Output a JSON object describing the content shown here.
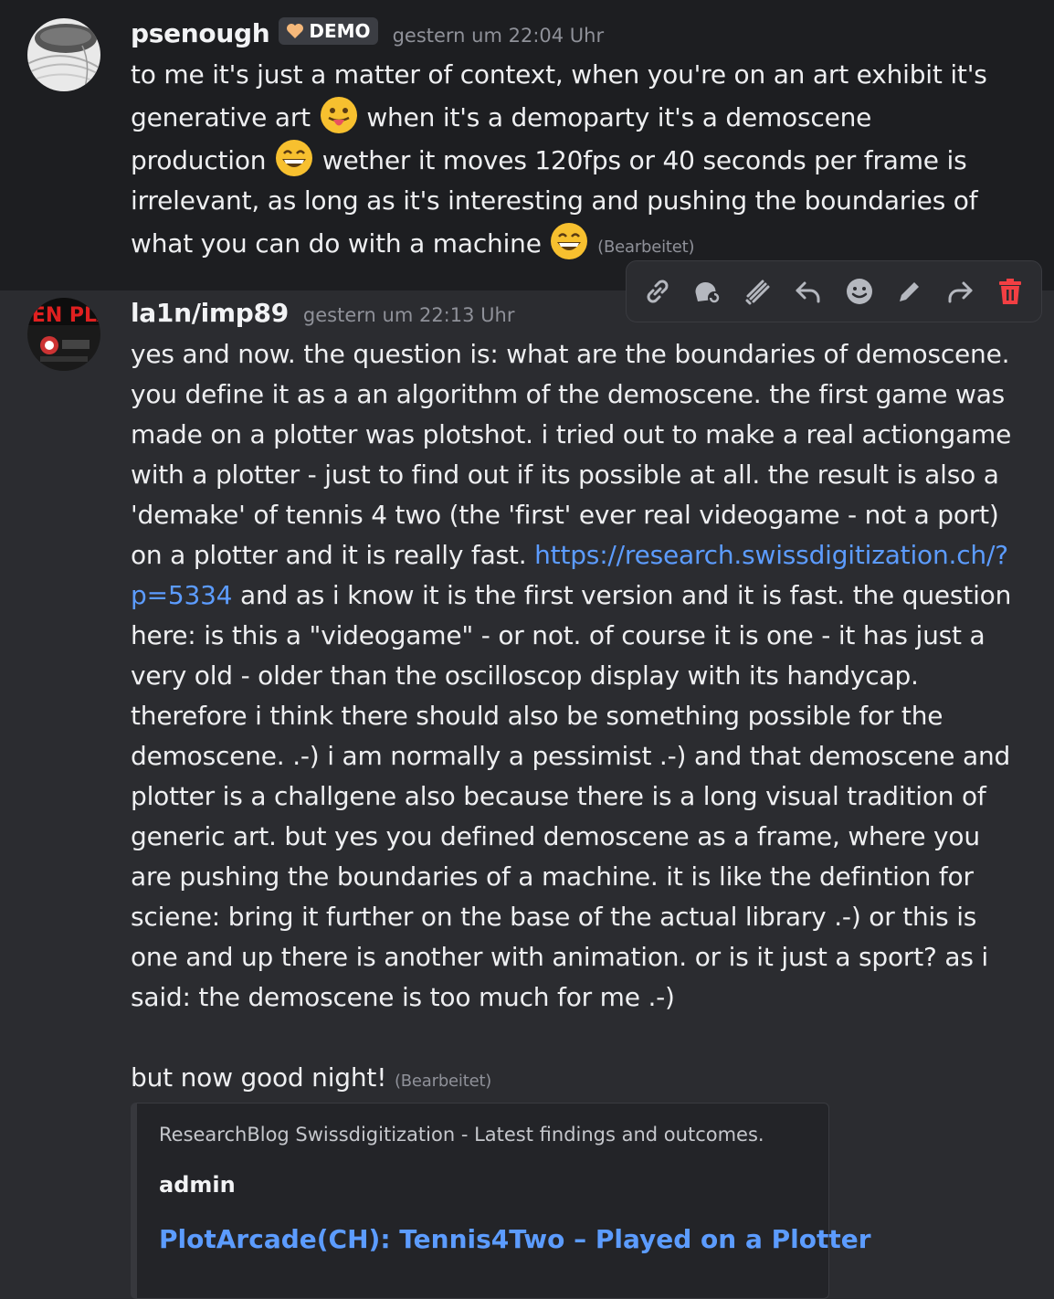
{
  "message1": {
    "username": "psenough",
    "badge_label": "DEMO",
    "timestamp": "gestern um 22:04 Uhr",
    "text_part1": "to me it's just a matter of context, when you're on an art exhibit it's generative art",
    "text_part2": " when it's a demoparty it's a demoscene production",
    "text_part3": " wether it moves 120fps or 40 seconds per frame is irrelevant, as long as it's interesting and pushing the boundaries of what you can do with a machine",
    "edited_label": "(Bearbeitet)"
  },
  "message2": {
    "username": "la1n/imp89",
    "avatar_text": "UEN PLA",
    "timestamp": "gestern um 22:13 Uhr",
    "text_before_link": "yes and now. the question is: what are the boundaries of demoscene. you define it as a an algorithm of the demoscene. the first game was made on a plotter was plotshot. i tried out to make a real actiongame with a plotter - just to find out if its possible at all. the result is also a 'demake' of tennis 4 two (the 'first' ever real videogame - not a port) on a plotter and it is really fast. ",
    "link_text": "https://research.swissdigitization.ch/?p=5334",
    "text_after_link": " and as i know it is the first version and it is fast. the question here: is this a \"videogame\" - or not. of course it is one - it has just a very old - older than the oscilloscop display with its handycap. therefore i think there should also be something possible for the demoscene. .-) i am normally a pessimist .-) and that demoscene and plotter is a challgene also because there is a long visual tradition of generic art. but yes you defined demoscene as a frame, where you are pushing the boundaries of a machine. it is like the defintion for sciene: bring it further on the base of the actual library .-) or this is one and up there is another with animation. or is it just a sport?  as i said: the demoscene is too much for me .-)",
    "text_final": "but now good night!",
    "edited_label": "(Bearbeitet)",
    "embed": {
      "provider": "ResearchBlog Swissdigitization - Latest findings and outcomes.",
      "author": "admin",
      "title": "PlotArcade(CH): Tennis4Two – Played on a Plotter"
    }
  },
  "toolbar": {
    "icons": [
      "link-icon",
      "thread-icon",
      "super-reaction-icon",
      "reply-icon",
      "emoji-icon",
      "edit-icon",
      "forward-icon",
      "delete-icon"
    ]
  },
  "colors": {
    "background": "#2b2c30",
    "highlight": "#1d1e21",
    "link": "#5c9cff",
    "delete": "#f23f43",
    "muted": "#8f9199"
  }
}
